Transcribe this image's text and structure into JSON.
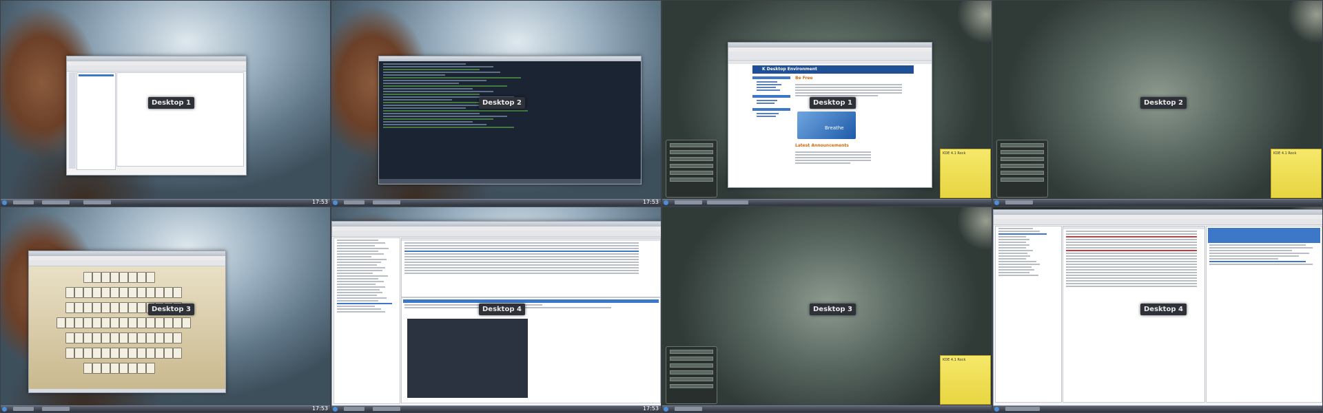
{
  "desktops": [
    {
      "label": "Desktop 1",
      "clock": "17:53"
    },
    {
      "label": "Desktop 2",
      "clock": "17:53"
    },
    {
      "label": "Desktop 1",
      "clock": ""
    },
    {
      "label": "Desktop 2",
      "clock": ""
    },
    {
      "label": "Desktop 3",
      "clock": "17:53"
    },
    {
      "label": "Desktop 4",
      "clock": "17:53"
    },
    {
      "label": "Desktop 3",
      "clock": ""
    },
    {
      "label": "Desktop 4",
      "clock": ""
    }
  ],
  "konqueror": {
    "heading": "K Desktop Environment",
    "intro_heading": "Be Free",
    "news_heading": "Latest Announcements",
    "splash": "Breathe"
  },
  "notes": {
    "note_a": "KDE 4.1 Rock",
    "note_b": "KDE 4.1 Rock",
    "note_c": "KDE 4.1 Rock"
  },
  "colors": {
    "taskbar": "#3d434e",
    "accent": "#3d78c8",
    "label_bg": "#2e3238",
    "note": "#f3e35a"
  },
  "icons": [
    "kde-menu-icon",
    "browser-icon",
    "terminal-icon",
    "mail-icon",
    "mahjong-icon"
  ]
}
